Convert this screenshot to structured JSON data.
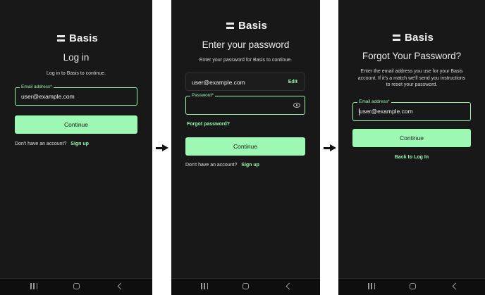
{
  "brand": {
    "name": "Basis"
  },
  "screen_login": {
    "title": "Log in",
    "subtitle": "Log in to Basis to continue.",
    "email_label": "Email address*",
    "email_value": "user@example.com",
    "continue_label": "Continue",
    "no_account_text": "Don't have an account?",
    "signup_label": "Sign up"
  },
  "screen_password": {
    "title": "Enter your password",
    "subtitle": "Enter your password for Basis to continue.",
    "email_value": "user@example.com",
    "edit_label": "Edit",
    "password_label": "Password*",
    "password_value": "",
    "forgot_label": "Forgot password?",
    "continue_label": "Continue",
    "no_account_text": "Don't have an account?",
    "signup_label": "Sign up"
  },
  "screen_forgot": {
    "title": "Forgot Your Password?",
    "subtitle_lines": [
      "Enter the email address you use for your Basis",
      "account. If it's a match we'll send you instructions",
      "to reset your password."
    ],
    "email_label": "Email address*",
    "email_value": "user@example.com",
    "continue_label": "Continue",
    "back_label": "Back to Log In"
  },
  "colors": {
    "background": "#181818",
    "accent": "#9af5b0",
    "button": "#9cf8b2",
    "text": "#ececec"
  },
  "icons": [
    "menu-lines-icon",
    "eye-icon",
    "arrow-right-icon",
    "recent-apps-icon",
    "home-icon",
    "back-icon"
  ]
}
